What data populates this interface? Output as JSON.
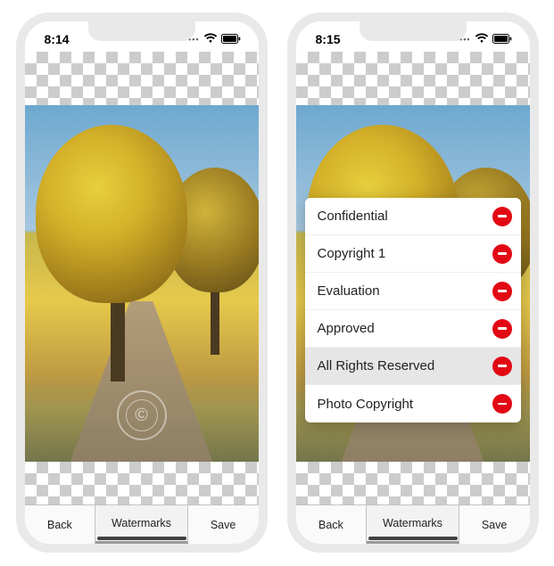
{
  "phones": {
    "left": {
      "status": {
        "time": "8:14"
      },
      "toolbar": {
        "back": "Back",
        "center": "Watermarks",
        "save": "Save"
      },
      "watermark_badge": "©"
    },
    "right": {
      "status": {
        "time": "8:15"
      },
      "toolbar": {
        "back": "Back",
        "center": "Watermarks",
        "save": "Save"
      },
      "menu": {
        "items": [
          {
            "label": "Confidential",
            "selected": false
          },
          {
            "label": "Copyright 1",
            "selected": false
          },
          {
            "label": "Evaluation",
            "selected": false
          },
          {
            "label": "Approved",
            "selected": false
          },
          {
            "label": "All Rights Reserved",
            "selected": true
          },
          {
            "label": "Photo Copyright",
            "selected": false
          }
        ]
      }
    }
  }
}
